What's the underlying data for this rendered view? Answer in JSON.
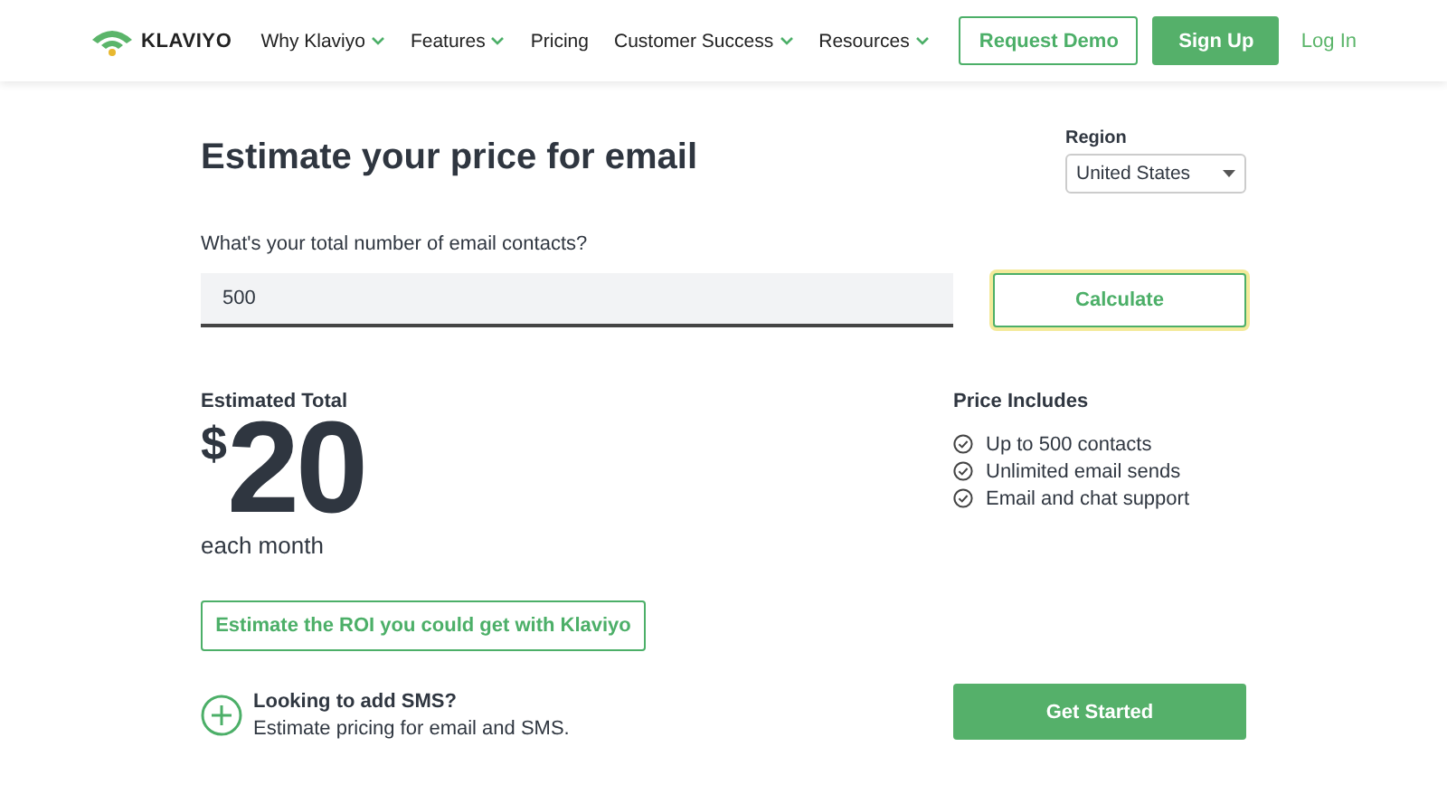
{
  "header": {
    "logo": "KLAVIYO",
    "nav": [
      {
        "label": "Why Klaviyo",
        "has_menu": true
      },
      {
        "label": "Features",
        "has_menu": true
      },
      {
        "label": "Pricing",
        "has_menu": false
      },
      {
        "label": "Customer Success",
        "has_menu": true
      },
      {
        "label": "Resources",
        "has_menu": true
      }
    ],
    "request_demo": "Request Demo",
    "sign_up": "Sign Up",
    "log_in": "Log In"
  },
  "calculator": {
    "title": "Estimate your price for email",
    "region": {
      "label": "Region",
      "value": "United States"
    },
    "contacts_label": "What's your total number of email contacts?",
    "contacts_value": "500",
    "calculate": {
      "label": "Calculate",
      "focused": true
    }
  },
  "estimate": {
    "label": "Estimated Total",
    "currency": "$",
    "amount": "20",
    "period": "each month",
    "roi_button": "Estimate the ROI you could get with Klaviyo",
    "sms": {
      "title": "Looking to add SMS?",
      "subtitle": "Estimate pricing for email and SMS."
    }
  },
  "includes": {
    "title": "Price Includes",
    "items": [
      "Up to 500 contacts",
      "Unlimited email sends",
      "Email and chat support"
    ],
    "get_started": "Get Started"
  }
}
